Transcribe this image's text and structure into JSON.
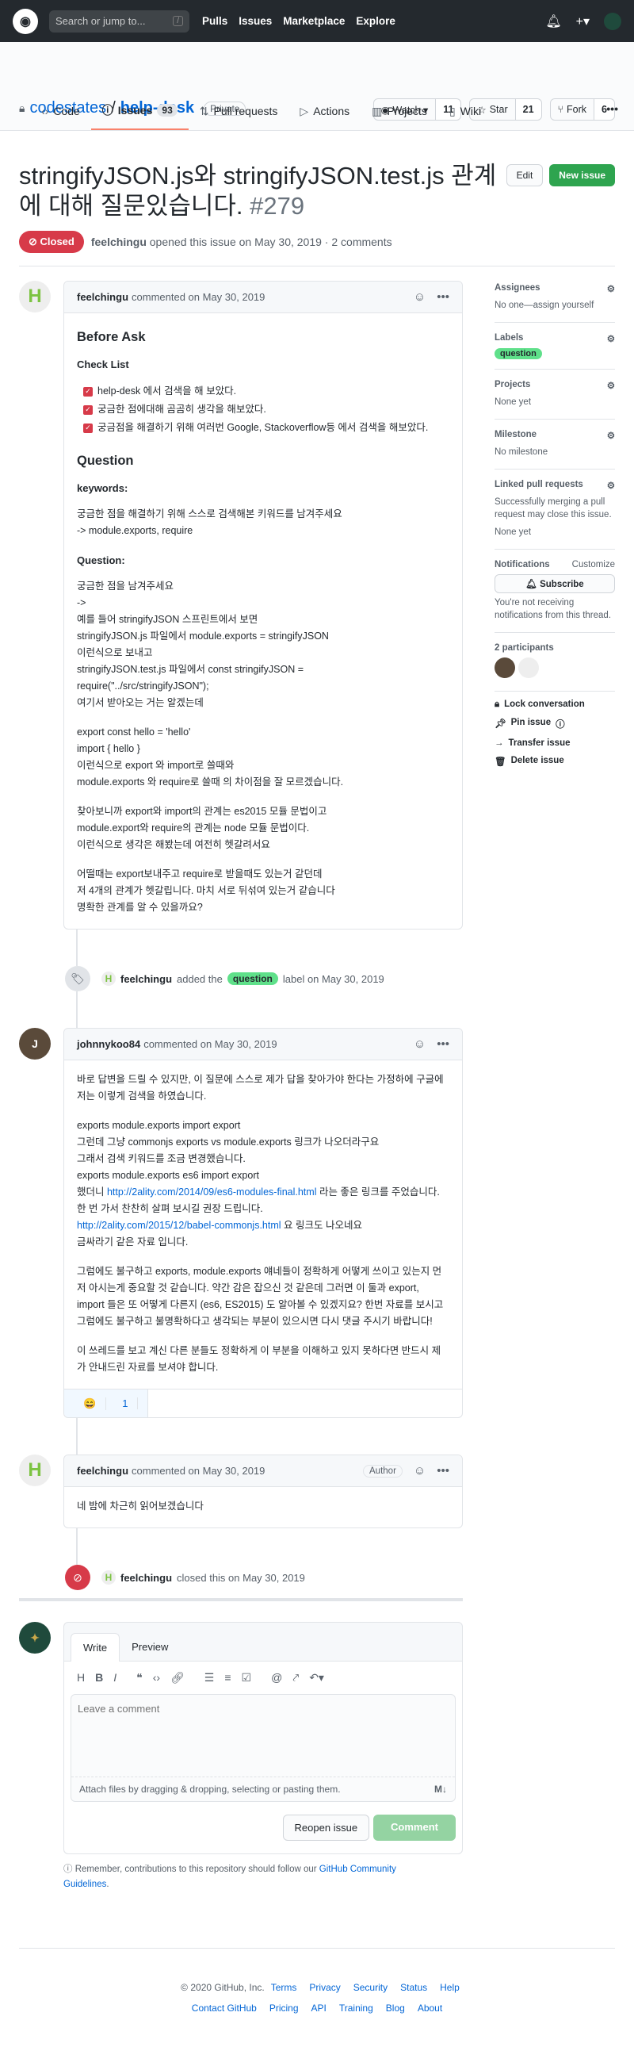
{
  "topbar": {
    "search_placeholder": "Search or jump to...",
    "slash": "/",
    "nav": [
      "Pulls",
      "Issues",
      "Marketplace",
      "Explore"
    ],
    "plus": "+▾"
  },
  "repo": {
    "owner": "codestates",
    "sep": "/",
    "name": "help-desk",
    "visibility": "Private",
    "watch": "Watch ▾",
    "watch_count": "11",
    "star": "Star",
    "star_count": "21",
    "fork": "Fork",
    "fork_count": "6"
  },
  "tabs": [
    {
      "label": "Code",
      "icon": "‹›"
    },
    {
      "label": "Issues",
      "icon": "ⓘ",
      "count": "93"
    },
    {
      "label": "Pull requests",
      "icon": "⇅"
    },
    {
      "label": "Actions",
      "icon": "▷"
    },
    {
      "label": "Projects",
      "icon": "▥"
    },
    {
      "label": "Wiki",
      "icon": "▯"
    }
  ],
  "issue": {
    "title": "stringifyJSON.js와 stringifyJSON.test.js 관계에 대해 질문있습니다.",
    "number": "#279",
    "edit": "Edit",
    "new_issue": "New issue",
    "state": "Closed",
    "author": "feelchingu",
    "meta": "opened this issue on May 30, 2019 · 2 comments"
  },
  "comments": [
    {
      "author": "feelchingu",
      "meta": "commented on May 30, 2019",
      "blocks": [
        {
          "type": "h2",
          "text": "Before Ask"
        },
        {
          "type": "h3",
          "text": "Check List"
        },
        {
          "type": "check",
          "items": [
            "help-desk 에서 검색을 해 보았다.",
            "궁금한 점에대해 곰곰히 생각을 해보았다.",
            "궁금점을 해결하기 위해 여러번 Google, Stackoverflow등 에서 검색을 해보았다."
          ]
        },
        {
          "type": "h2",
          "text": "Question"
        },
        {
          "type": "h3",
          "text": "keywords:"
        },
        {
          "type": "p",
          "lines": [
            "궁금한 점을 해결하기 위해 스스로 검색해본 키워드를 남겨주세요",
            "-> module.exports, require"
          ]
        },
        {
          "type": "h3",
          "text": "Question:"
        },
        {
          "type": "p",
          "lines": [
            "궁금한 점을 남겨주세요",
            "->",
            "예를 들어 stringifyJSON 스프린트에서 보면",
            "stringifyJSON.js 파일에서 module.exports = stringifyJSON",
            "이런식으로 보내고",
            "stringifyJSON.test.js 파일에서 const stringifyJSON =",
            "require(\"../src/stringifyJSON\");",
            "여기서 받아오는 거는 알겠는데"
          ]
        },
        {
          "type": "p",
          "lines": [
            "export const hello = 'hello'",
            "import { hello }",
            "이런식으로 export 와 import로 쓸때와",
            "module.exports 와 require로 쓸때 의 차이점을 잘 모르겠습니다."
          ]
        },
        {
          "type": "p",
          "lines": [
            "찾아보니까 export와 import의 관계는 es2015 모듈 문법이고",
            "module.export와 require의 관계는 node 모듈 문법이다.",
            "이런식으로 생각은 해봤는데 여전히 헷갈려서요"
          ]
        },
        {
          "type": "p",
          "lines": [
            "어떨때는 export보내주고 require로 받을때도 있는거 같던데",
            "저 4개의 관계가 헷갈립니다. 마치 서로 뒤섞여 있는거 같습니다",
            "명확한 관계를 알 수 있을까요?"
          ]
        }
      ]
    },
    {
      "author": "johnnykoo84",
      "meta": "commented on May 30, 2019",
      "reaction": {
        "emoji": "😄",
        "count": "1"
      },
      "blocks": [
        {
          "type": "p",
          "lines": [
            "바로 답변을 드릴 수 있지만, 이 질문에 스스로 제가 답을 찾아가야 한다는 가정하에 구글에 저는 이렇게 검색을 하였습니다."
          ]
        },
        {
          "type": "p",
          "lines": [
            "exports module.exports import export",
            "그런데 그냥 commonjs exports vs module.exports 링크가 나오더라구요",
            "그래서 검색 키워드를 조금 변경했습니다.",
            "exports module.exports es6 import export",
            [
              {
                "t": "했더니 "
              },
              {
                "t": "http://2ality.com/2014/09/es6-modules-final.html",
                "link": true
              },
              {
                "t": " 라는 좋은 링크를 주었습니다. 한 번 가서 찬찬히 살펴 보시길 권장 드립니다."
              }
            ],
            [
              {
                "t": "http://2ality.com/2015/12/babel-commonjs.html",
                "link": true
              },
              {
                "t": " 요 링크도 나오네요"
              }
            ],
            "금싸라기 같은 자료 입니다."
          ]
        },
        {
          "type": "p",
          "lines": [
            "그럼에도 불구하고 exports, module.exports 얘네들이 정확하게 어떻게 쓰이고 있는지 먼저 아시는게 중요할 것 같습니다. 약간 감은 잡으신 것 같은데 그러면 이 둘과 export, import 들은 또 어떻게 다른지 (es6, ES2015) 도 알아볼 수 있겠지요? 한번 자료를 보시고 그럼에도 불구하고 불명확하다고 생각되는 부분이 있으시면 다시 댓글 주시기 바랍니다!"
          ]
        },
        {
          "type": "p",
          "lines": [
            "이 쓰레드를 보고 계신 다른 분들도 정확하게 이 부분을 이해하고 있지 못하다면 반드시 제가 안내드린 자료를 보셔야 합니다."
          ]
        }
      ]
    },
    {
      "author": "feelchingu",
      "meta": "commented on May 30, 2019",
      "badge": "Author",
      "blocks": [
        {
          "type": "p",
          "lines": [
            "네 밤에 차근히 읽어보겠습니다"
          ]
        }
      ]
    }
  ],
  "events": {
    "label": {
      "actor": "feelchingu",
      "text1": "added the",
      "label": "question",
      "text2": "label on May 30, 2019"
    },
    "closed": {
      "actor": "feelchingu",
      "text": "closed this on May 30, 2019"
    }
  },
  "form": {
    "write": "Write",
    "preview": "Preview",
    "placeholder": "Leave a comment",
    "attach": "Attach files by dragging & dropping, selecting or pasting them.",
    "md": "M↓",
    "reopen": "Reopen issue",
    "comment": "Comment",
    "remember": "Remember, contributions to this repository should follow our ",
    "guidelines": "GitHub Community Guidelines",
    "period": "."
  },
  "sidebar": {
    "assignees": {
      "title": "Assignees",
      "value": "No one—assign yourself"
    },
    "labels": {
      "title": "Labels",
      "value": "question"
    },
    "projects": {
      "title": "Projects",
      "value": "None yet"
    },
    "milestone": {
      "title": "Milestone",
      "value": "No milestone"
    },
    "linked": {
      "title": "Linked pull requests",
      "desc": "Successfully merging a pull request may close this issue.",
      "value": "None yet"
    },
    "notifications": {
      "title": "Notifications",
      "customize": "Customize",
      "subscribe": "Subscribe",
      "desc": "You're not receiving notifications from this thread."
    },
    "participants": {
      "title": "2 participants"
    },
    "actions": [
      "Lock conversation",
      "Pin issue",
      "Transfer issue",
      "Delete issue"
    ]
  },
  "footer": {
    "copyright": "© 2020 GitHub, Inc.",
    "row1": [
      "Terms",
      "Privacy",
      "Security",
      "Status",
      "Help"
    ],
    "row2": [
      "Contact GitHub",
      "Pricing",
      "API",
      "Training",
      "Blog",
      "About"
    ]
  },
  "colors": {
    "accent": "#0366d6",
    "closed": "#d73a49",
    "label": "#5fe08a",
    "green": "#2ea44f"
  }
}
